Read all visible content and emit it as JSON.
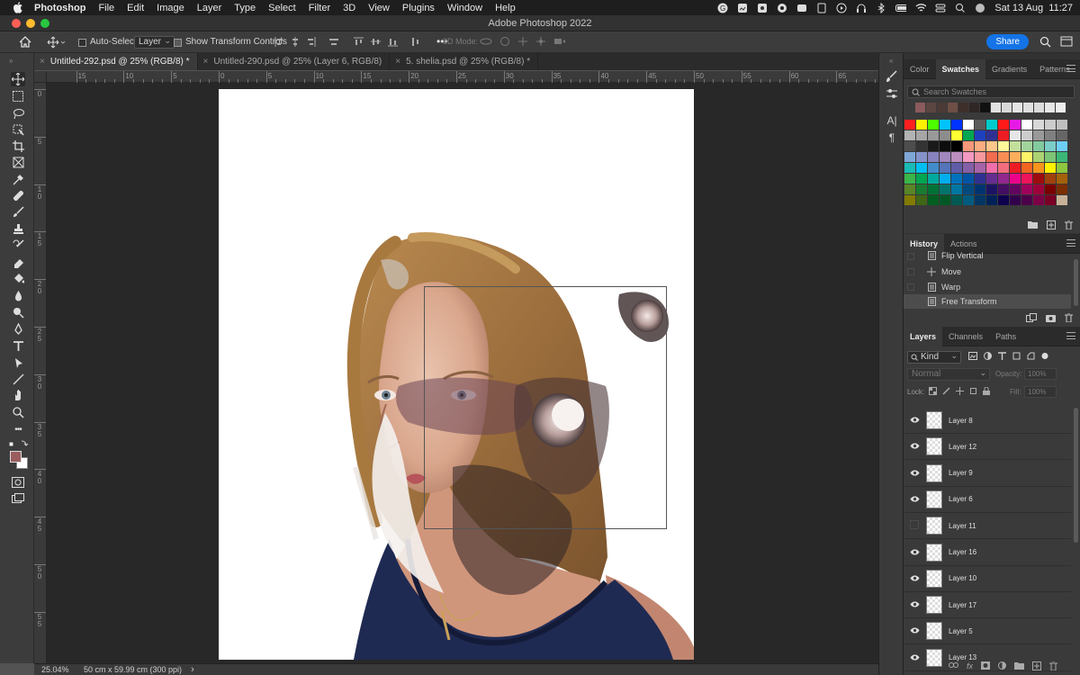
{
  "menubar": {
    "app_name": "Photoshop",
    "items": [
      "File",
      "Edit",
      "Image",
      "Layer",
      "Type",
      "Select",
      "Filter",
      "3D",
      "View",
      "Plugins",
      "Window",
      "Help"
    ],
    "clock": "Sat 13 Aug  11:27"
  },
  "window": {
    "title": "Adobe Photoshop 2022"
  },
  "options_bar": {
    "auto_select_label": "Auto-Select:",
    "auto_select_value": "Layer",
    "show_transform_label": "Show Transform Controls",
    "mode_3d_label": "3D Mode:",
    "share_label": "Share"
  },
  "doc_tabs": [
    {
      "label": "Untitled-292.psd @ 25% (RGB/8) *",
      "active": true
    },
    {
      "label": "Untitled-290.psd @ 25% (Layer 6, RGB/8)",
      "active": false
    },
    {
      "label": "5. shelia.psd @ 25% (RGB/8) *",
      "active": false
    }
  ],
  "ruler_top_labels": [
    "15",
    "10",
    "5",
    "0",
    "5",
    "10",
    "15",
    "20",
    "25",
    "30",
    "35",
    "40",
    "45",
    "50",
    "55",
    "60",
    "65"
  ],
  "ruler_left_labels": [
    "0",
    "5",
    "1 0",
    "1 5",
    "2 0",
    "2 5",
    "3 0",
    "3 5",
    "4 0",
    "4 5",
    "5 0",
    "5 5"
  ],
  "status_bar": {
    "zoom": "25.04%",
    "doc_info": "50 cm x 59.99 cm (300 ppi)",
    "arrow": "›"
  },
  "colors": {
    "foreground": "#9a5d5e",
    "background": "#ffffff",
    "accent": "#1473e6"
  },
  "swatches_panel": {
    "tabs": [
      "Color",
      "Swatches",
      "Gradients",
      "Patterns"
    ],
    "active_tab": "Swatches",
    "search_placeholder": "Search Swatches",
    "recent": [
      "#8a5a5c",
      "#5b4541",
      "#4b3a36",
      "#6e4f45",
      "#3e2f2b",
      "#2e2725",
      "#111111",
      "#e2e2e2",
      "#d9d9d9",
      "#e5e5e5",
      "#e0e0e0",
      "#dcdcdc",
      "#e7e7e7",
      "#ededed"
    ],
    "grid": [
      [
        "#ff1f1f",
        "#fff200",
        "#4cff00",
        "#00c2ff",
        "#0033ff",
        "#ffffff",
        "#5c5c5c",
        "#00cccc",
        "#ff1a1a",
        "#e61ae6",
        "#ffffff",
        "#d8d8d8",
        "#cccccc",
        "#bfbfbf"
      ],
      [
        "#b3b3b3",
        "#a6a6a6",
        "#999999",
        "#8c8c8c",
        "#ffff33",
        "#00a651",
        "#1f3fbf",
        "#2e3192",
        "#ed1c24",
        "#e6e6e6",
        "#cccccc",
        "#999999",
        "#808080",
        "#666666"
      ],
      [
        "#4d4d4d",
        "#333333",
        "#1a1a1a",
        "#0d0d0d",
        "#000000",
        "#f7977a",
        "#f9ad81",
        "#fdc68a",
        "#fff79a",
        "#c4df9b",
        "#a3d39c",
        "#82ca9d",
        "#7bcdc8",
        "#6ecff6"
      ],
      [
        "#7ea7d8",
        "#8493ca",
        "#8882be",
        "#a187be",
        "#bc8dbf",
        "#f49ac2",
        "#f6989d",
        "#f26c4f",
        "#f68e55",
        "#fbaf5c",
        "#fff467",
        "#acd372",
        "#7cc576",
        "#3bb878"
      ],
      [
        "#1abbb4",
        "#00bff3",
        "#438ccb",
        "#5574b9",
        "#605ca8",
        "#855fa8",
        "#a763a8",
        "#f06ea9",
        "#f26d7d",
        "#ed1c24",
        "#f26522",
        "#f7941d",
        "#fff200",
        "#8dc63f"
      ],
      [
        "#39b54a",
        "#00a651",
        "#00a99d",
        "#00aeef",
        "#0072bc",
        "#0054a6",
        "#2e3192",
        "#662d91",
        "#92278f",
        "#ec008c",
        "#ed145b",
        "#9e0b0f",
        "#a0410d",
        "#a36209"
      ],
      [
        "#598527",
        "#197b30",
        "#007236",
        "#00746b",
        "#0076a3",
        "#004a80",
        "#003471",
        "#1b1464",
        "#440e62",
        "#630460",
        "#9e005d",
        "#9e0039",
        "#790000",
        "#7b2e00"
      ],
      [
        "#827b00",
        "#406618",
        "#005e20",
        "#005826",
        "#005952",
        "#005b7f",
        "#003663",
        "#002157",
        "#0d004c",
        "#32004b",
        "#4b0049",
        "#7b0046",
        "#7a0026",
        "#c7b299"
      ]
    ]
  },
  "history_panel": {
    "tabs": [
      "History",
      "Actions"
    ],
    "active_tab": "History",
    "items": [
      {
        "label": "Flip Vertical",
        "icon": "document-icon",
        "active": false
      },
      {
        "label": "Move",
        "icon": "move-icon",
        "active": false
      },
      {
        "label": "Warp",
        "icon": "document-icon",
        "active": false
      },
      {
        "label": "Free Transform",
        "icon": "document-icon",
        "active": true
      }
    ]
  },
  "layers_panel": {
    "tabs": [
      "Layers",
      "Channels",
      "Paths"
    ],
    "active_tab": "Layers",
    "filter_value": "Kind",
    "blend_mode": "Normal",
    "opacity_label": "Opacity:",
    "opacity_value": "100%",
    "lock_label": "Lock:",
    "fill_label": "Fill:",
    "fill_value": "100%",
    "layers": [
      {
        "name": "Layer 8",
        "visible": true
      },
      {
        "name": "Layer 12",
        "visible": true
      },
      {
        "name": "Layer 9",
        "visible": true
      },
      {
        "name": "Layer 6",
        "visible": true
      },
      {
        "name": "Layer 11",
        "visible": false
      },
      {
        "name": "Layer 16",
        "visible": true
      },
      {
        "name": "Layer 10",
        "visible": true
      },
      {
        "name": "Layer 17",
        "visible": true
      },
      {
        "name": "Layer 5",
        "visible": true
      },
      {
        "name": "Layer 13",
        "visible": true
      }
    ]
  }
}
